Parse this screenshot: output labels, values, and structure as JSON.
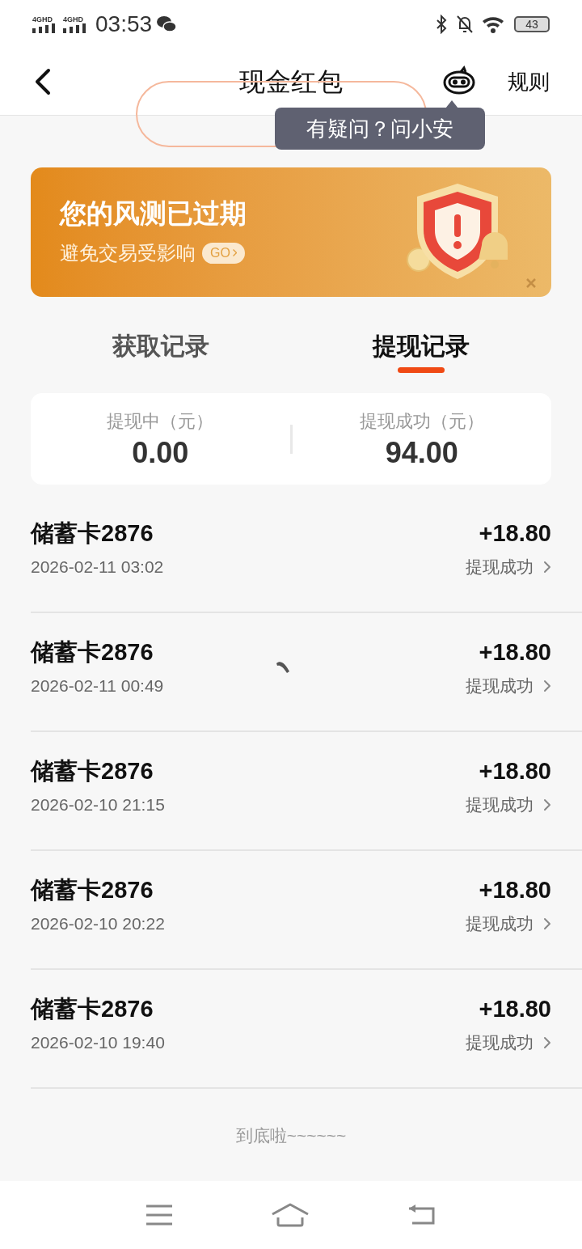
{
  "status_bar": {
    "network_1": "4GHD",
    "network_2": "4GHD",
    "time": "03:53",
    "battery": "43"
  },
  "header": {
    "title": "现金红包",
    "rules": "规则"
  },
  "tooltip": "有疑问？问小安",
  "banner": {
    "title": "您的风测已过期",
    "subtitle": "避免交易受影响",
    "go": "GO"
  },
  "tabs": [
    {
      "label": "获取记录",
      "selected": false
    },
    {
      "label": "提现记录",
      "selected": true
    }
  ],
  "summary": [
    {
      "label": "提现中（元）",
      "value": "0.00"
    },
    {
      "label": "提现成功（元）",
      "value": "94.00"
    }
  ],
  "records": [
    {
      "card": "储蓄卡2876",
      "time": "2026-02-11 03:02",
      "amount": "+18.80",
      "status": "提现成功"
    },
    {
      "card": "储蓄卡2876",
      "time": "2026-02-11 00:49",
      "amount": "+18.80",
      "status": "提现成功",
      "mark": true
    },
    {
      "card": "储蓄卡2876",
      "time": "2026-02-10 21:15",
      "amount": "+18.80",
      "status": "提现成功"
    },
    {
      "card": "储蓄卡2876",
      "time": "2026-02-10 20:22",
      "amount": "+18.80",
      "status": "提现成功"
    },
    {
      "card": "储蓄卡2876",
      "time": "2026-02-10 19:40",
      "amount": "+18.80",
      "status": "提现成功"
    }
  ],
  "footer": "到底啦~~~~~~"
}
